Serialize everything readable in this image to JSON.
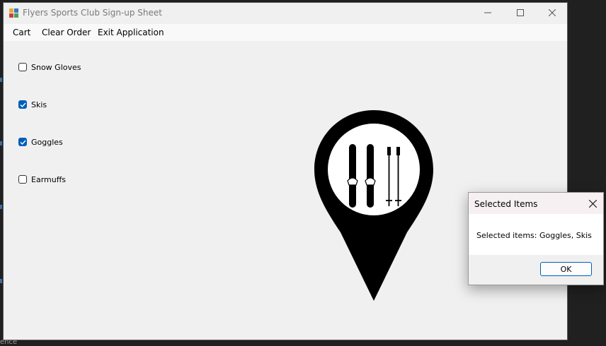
{
  "background": {
    "partial_text": "ence"
  },
  "window": {
    "title": "Flyers Sports Club Sign-up Sheet",
    "controls": [
      "minimize-icon",
      "maximize-icon",
      "close-icon"
    ]
  },
  "menu": {
    "items": [
      {
        "label": "Cart"
      },
      {
        "label": "Clear Order"
      },
      {
        "label": "Exit Application"
      }
    ]
  },
  "checkboxes": [
    {
      "label": "Snow Gloves",
      "checked": false
    },
    {
      "label": "Skis",
      "checked": true
    },
    {
      "label": "Goggles",
      "checked": true
    },
    {
      "label": "Earmuffs",
      "checked": false
    }
  ],
  "image": {
    "icon": "ski-location-pin-icon"
  },
  "dialog": {
    "title": "Selected Items",
    "message": "Selected items: Goggles, Skis",
    "ok_label": "OK"
  },
  "colors": {
    "accent": "#005fb8",
    "window_bg": "#f0f0f0",
    "desktop_bg": "#202020"
  }
}
